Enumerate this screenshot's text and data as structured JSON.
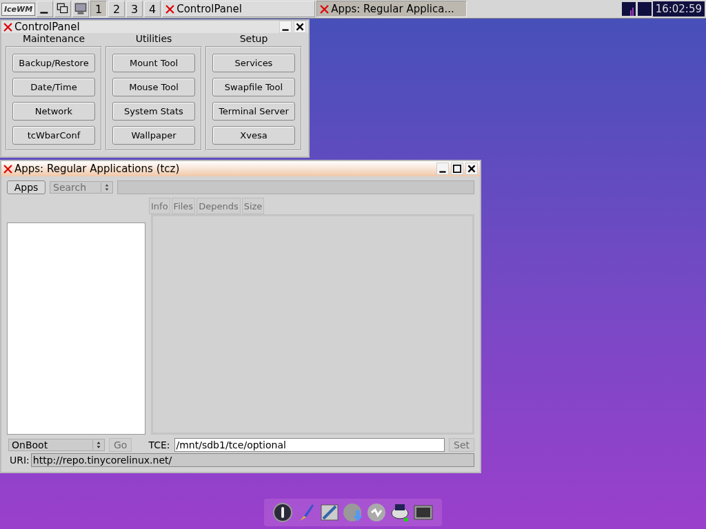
{
  "taskbar": {
    "logo": "IceWM",
    "workspaces": [
      {
        "label": "1",
        "selected": true
      },
      {
        "label": "2",
        "selected": false
      },
      {
        "label": "3",
        "selected": false
      },
      {
        "label": "4",
        "selected": false
      }
    ],
    "tasks": [
      {
        "title": "ControlPanel",
        "selected": false
      },
      {
        "title": "Apps: Regular Applica...",
        "selected": true
      }
    ],
    "clock": "16:02:59"
  },
  "control_panel": {
    "title": "ControlPanel",
    "groups": [
      {
        "title": "Maintenance",
        "buttons": [
          "Backup/Restore",
          "Date/Time",
          "Network",
          "tcWbarConf"
        ]
      },
      {
        "title": "Utilities",
        "buttons": [
          "Mount Tool",
          "Mouse Tool",
          "System Stats",
          "Wallpaper"
        ]
      },
      {
        "title": "Setup",
        "buttons": [
          "Services",
          "Swapfile Tool",
          "Terminal Server",
          "Xvesa"
        ]
      }
    ]
  },
  "apps_window": {
    "title": "Apps: Regular Applications (tcz)",
    "apps_button": "Apps",
    "search_select": {
      "value": "Search",
      "disabled": true
    },
    "tabs": [
      {
        "label": "Info",
        "disabled": true
      },
      {
        "label": "Files",
        "disabled": true
      },
      {
        "label": "Depends",
        "disabled": true
      },
      {
        "label": "Size",
        "disabled": true
      }
    ],
    "onboot_select": "OnBoot",
    "go_button": {
      "label": "Go",
      "disabled": true
    },
    "tce_label": "TCE:",
    "tce_value": "/mnt/sdb1/tce/optional",
    "set_button": {
      "label": "Set",
      "disabled": true
    },
    "uri_label": "URI:",
    "uri_value": "http://repo.tinycorelinux.net/"
  }
}
